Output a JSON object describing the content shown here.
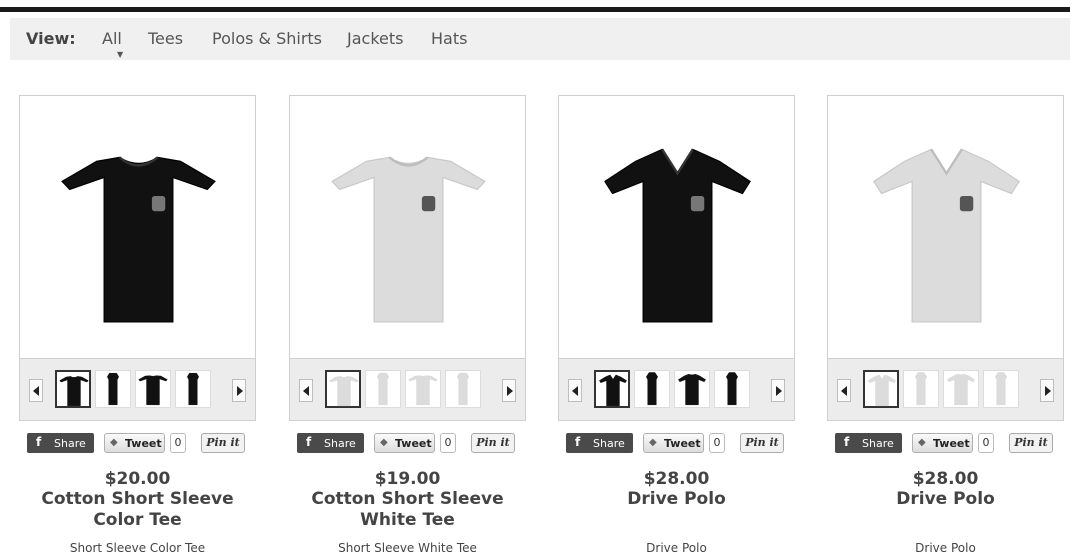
{
  "filter_bar": {
    "label": "View:",
    "filters": [
      "All",
      "Tees",
      "Polos & Shirts",
      "Jackets",
      "Hats"
    ],
    "active": "All"
  },
  "products": [
    {
      "price": "$20.00",
      "name": "Cotton Short Sleeve Color Tee",
      "subtitle": "Short Sleeve Color Tee",
      "garment": "tee",
      "color": "#111111",
      "share_label": "Share",
      "tweet_label": "Tweet",
      "tweet_count": "0",
      "pin_label": "Pin it"
    },
    {
      "price": "$19.00",
      "name": "Cotton Short Sleeve White Tee",
      "subtitle": "Short Sleeve White Tee",
      "garment": "tee",
      "color": "#dcdcdc",
      "share_label": "Share",
      "tweet_label": "Tweet",
      "tweet_count": "0",
      "pin_label": "Pin it"
    },
    {
      "price": "$28.00",
      "name": "Drive Polo",
      "subtitle": "Drive Polo",
      "garment": "polo",
      "color": "#111111",
      "share_label": "Share",
      "tweet_label": "Tweet",
      "tweet_count": "0",
      "pin_label": "Pin it"
    },
    {
      "price": "$28.00",
      "name": "Drive Polo",
      "subtitle": "Drive Polo",
      "garment": "polo",
      "color": "#dcdcdc",
      "share_label": "Share",
      "tweet_label": "Tweet",
      "tweet_count": "0",
      "pin_label": "Pin it"
    }
  ]
}
